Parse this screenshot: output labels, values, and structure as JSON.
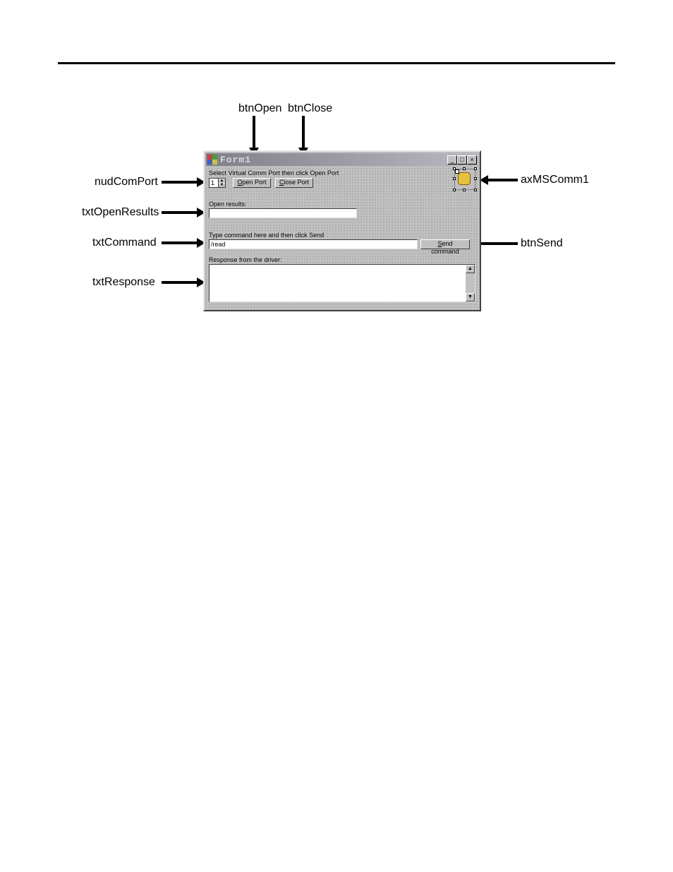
{
  "callouts": {
    "btnOpen": "btnOpen",
    "btnClose": "btnClose",
    "nudComPort": "nudComPort",
    "txtOpenResults": "txtOpenResults",
    "txtCommand": "txtCommand",
    "txtResponse": "txtResponse",
    "axMSComm1": "axMSComm1",
    "btnSend": "btnSend"
  },
  "form": {
    "title": "Form1",
    "labels": {
      "selectPort": "Select Virtual Comm Port then click Open Port",
      "openResults": "Open results:",
      "typeCommand": "Type command here and then click Send",
      "response": "Response from the driver:"
    },
    "buttons": {
      "openPort": "Open Port",
      "closePort": "Close Port",
      "sendCommand": "Send command"
    },
    "values": {
      "nudComPort": "1",
      "txtOpenResults": "",
      "txtCommand": "/read",
      "txtResponse": ""
    }
  }
}
